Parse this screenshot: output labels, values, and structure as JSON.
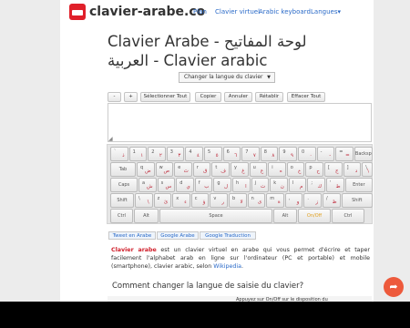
{
  "header": {
    "site_name": "clavier-arabe.co",
    "nav": [
      "Plan",
      "Clavier virtuel",
      "Arabic keyboard",
      "Langues▾"
    ]
  },
  "title": "Clavier Arabe - لوحة المفاتيح العربية - Clavier arabic",
  "language_select": "Changer la langue du clavier",
  "toolbar": [
    "-",
    "+",
    "Sélectionner Tout",
    "Copier",
    "Annuler",
    "Rétablir",
    "Effacer Tout"
  ],
  "keyboard": {
    "row1": [
      {
        "s": "`",
        "a": "ذ"
      },
      {
        "s": "1",
        "a": "١"
      },
      {
        "s": "2",
        "a": "٢"
      },
      {
        "s": "3",
        "a": "٣"
      },
      {
        "s": "4",
        "a": "٤"
      },
      {
        "s": "5",
        "a": "٥"
      },
      {
        "s": "6",
        "a": "٦"
      },
      {
        "s": "7",
        "a": "٧"
      },
      {
        "s": "8",
        "a": "٨"
      },
      {
        "s": "9",
        "a": "٩"
      },
      {
        "s": "0",
        "a": "٠"
      },
      {
        "s": "-",
        "a": "-"
      },
      {
        "s": "=",
        "a": "="
      },
      {
        "c": "Backsp"
      }
    ],
    "row2": [
      {
        "c": "Tab"
      },
      {
        "s": "q",
        "a": "ض"
      },
      {
        "s": "w",
        "a": "ص"
      },
      {
        "s": "e",
        "a": "ث"
      },
      {
        "s": "r",
        "a": "ق"
      },
      {
        "s": "t",
        "a": "ف"
      },
      {
        "s": "y",
        "a": "غ"
      },
      {
        "s": "u",
        "a": "ع"
      },
      {
        "s": "i",
        "a": "ه"
      },
      {
        "s": "o",
        "a": "خ"
      },
      {
        "s": "p",
        "a": "ح"
      },
      {
        "s": "[",
        "a": "ج"
      },
      {
        "s": "]",
        "a": "د"
      },
      {
        "s": "\\",
        "a": "\\"
      }
    ],
    "row3": [
      {
        "c": "Caps"
      },
      {
        "s": "a",
        "a": "ش"
      },
      {
        "s": "s",
        "a": "س"
      },
      {
        "s": "d",
        "a": "ي"
      },
      {
        "s": "f",
        "a": "ب"
      },
      {
        "s": "g",
        "a": "ل"
      },
      {
        "s": "h",
        "a": "ا"
      },
      {
        "s": "j",
        "a": "ت"
      },
      {
        "s": "k",
        "a": "ن"
      },
      {
        "s": "l",
        "a": "م"
      },
      {
        "s": ";",
        "a": "ك"
      },
      {
        "s": "'",
        "a": "ط"
      },
      {
        "c": "Enter"
      }
    ],
    "row4": [
      {
        "c": "Shift"
      },
      {
        "s": "\\",
        "a": "\\"
      },
      {
        "s": "z",
        "a": "ئ"
      },
      {
        "s": "x",
        "a": "ء"
      },
      {
        "s": "c",
        "a": "ؤ"
      },
      {
        "s": "v",
        "a": "ر"
      },
      {
        "s": "b",
        "a": "لا"
      },
      {
        "s": "n",
        "a": "ى"
      },
      {
        "s": "m",
        "a": "ة"
      },
      {
        "s": ",",
        "a": "و"
      },
      {
        "s": ".",
        "a": "ز"
      },
      {
        "s": "/",
        "a": "ظ"
      },
      {
        "c": "Shift"
      }
    ],
    "row5": [
      {
        "c": "Ctrl"
      },
      {
        "c": "Alt"
      },
      {
        "c": "Space"
      },
      {
        "c": "Alt"
      },
      {
        "c": "On/Off",
        "on": true
      },
      {
        "c": "Ctrl"
      }
    ]
  },
  "share_buttons": [
    "Tweet en Arabe",
    "Google Arabe",
    "Google Traduction"
  ],
  "paragraph": {
    "bold": "Clavier arabe",
    "text": " est un clavier virtuel en arabe qui vous permet d'écrire et taper facilement l'alphabet arab en ligne sur l'ordinateur (PC et portable) et mobile (smartphone), clavier arabic, selon ",
    "link": "Wikipedia",
    "end": "."
  },
  "section_heading": "Comment changer la langue de saisie du clavier?",
  "next_text": "Appuyez sur On/Off sur le disposition du",
  "colors": {
    "accent": "#2a6ac8",
    "brand": "#e0202a",
    "arabic": "#c03040",
    "share_fab": "#ed5a3c"
  }
}
